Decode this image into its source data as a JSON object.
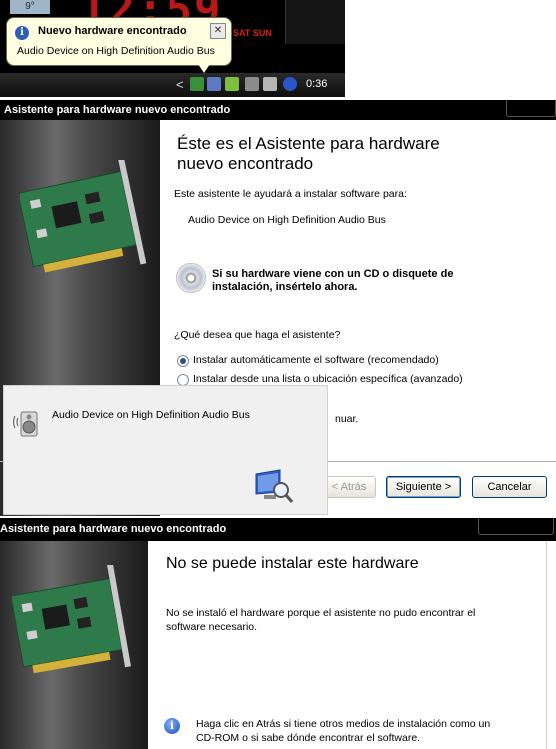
{
  "taskbar": {
    "temperature": "9°",
    "clock_digits": "12:59",
    "day_labels": "SAT  SUN",
    "tray_time": "0:36",
    "chevron": "<"
  },
  "balloon": {
    "icon": "info-icon",
    "title": "Nuevo hardware encontrado",
    "message": "Audio Device on High Definition Audio Bus",
    "close_glyph": "✕"
  },
  "wizard1": {
    "window_title": "Asistente para hardware nuevo encontrado",
    "heading_line1": "Éste es el Asistente para hardware",
    "heading_line2": "nuevo encontrado",
    "intro": "Este asistente le ayudará a instalar software para:",
    "device": "Audio Device on High Definition Audio Bus",
    "cd_prompt_line1": "Si su hardware viene con un CD o disquete de",
    "cd_prompt_line2": "instalación, insértelo ahora.",
    "question": "¿Qué desea que haga el asistente?",
    "options": [
      {
        "label": "Instalar automáticamente el software (recomendado)",
        "selected": true
      },
      {
        "label": "Instalar desde una lista o ubicación específica (avanzado)",
        "selected": false
      }
    ],
    "continue_fragment": "nuar.",
    "buttons": {
      "back": "< Atrás",
      "next": "Siguiente >",
      "cancel": "Cancelar"
    }
  },
  "overlay": {
    "device": "Audio Device on High Definition Audio Bus",
    "speaker_icon": "speaker-icon",
    "search_icon": "monitor-search-icon"
  },
  "wizard2": {
    "window_title": "Asistente para hardware nuevo encontrado",
    "heading": "No se puede instalar este hardware",
    "message_line1": "No se instaló el hardware porque el asistente no pudo encontrar el",
    "message_line2": "software necesario.",
    "hint_line1": "Haga clic en Atrás si tiene otros medios de instalación como un",
    "hint_line2": "CD-ROM o si sabe dónde encontrar el software."
  },
  "colors": {
    "clock_red": "#d71d1d",
    "balloon_bg": "#ffffe1",
    "titlebar": "#000000",
    "radio_selected": "#2b4e8c"
  }
}
